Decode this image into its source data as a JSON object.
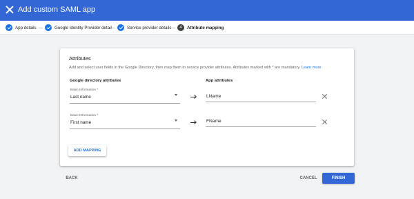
{
  "header": {
    "title": "Add custom SAML app",
    "close_icon": "close-icon",
    "color": "#3367d6"
  },
  "steps": [
    {
      "number": "",
      "label": "App details",
      "state": "done"
    },
    {
      "number": "",
      "label": "Google Identity Provider detail",
      "state": "done"
    },
    {
      "number": "",
      "label": "Service provider details",
      "state": "done"
    },
    {
      "number": "4",
      "label": "Attribute mapping",
      "state": "active"
    }
  ],
  "card": {
    "title": "Attributes",
    "description": "Add and select user fields in the Google Directory, then map them to service provider attributes. Attributes marked with * are mandatory.",
    "learn_more": "Learn more",
    "col_google": "Google directory attributes",
    "col_app": "App attributes",
    "mappings": [
      {
        "category": "Basic Information *",
        "directory_value": "Last name",
        "app_value": "LName"
      },
      {
        "category": "Basic Information *",
        "directory_value": "First name",
        "app_value": "FName"
      }
    ],
    "add_mapping": "ADD MAPPING"
  },
  "footer": {
    "back": "BACK",
    "cancel": "CANCEL",
    "finish": "FINISH"
  },
  "colors": {
    "primary": "#1a73e8",
    "header": "#3367d6",
    "background": "#f1f3f4"
  }
}
